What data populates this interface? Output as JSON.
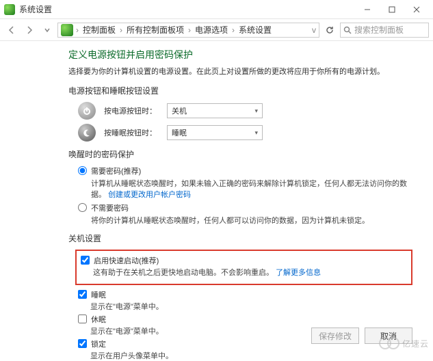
{
  "window": {
    "title": "系统设置",
    "min": "–",
    "max": "□",
    "close": "×"
  },
  "nav": {
    "crumbs": [
      "控制面板",
      "所有控制面板项",
      "电源选项",
      "系统设置"
    ],
    "search_placeholder": "搜索控制面板"
  },
  "heading": "定义电源按钮并启用密码保护",
  "subheading": "选择要为你的计算机设置的电源设置。在此页上对设置所做的更改将应用于你所有的电源计划。",
  "section_power_buttons": "电源按钮和睡眠按钮设置",
  "power_row": {
    "label": "按电源按钮时：",
    "value": "关机"
  },
  "sleep_row": {
    "label": "按睡眠按钮时：",
    "value": "睡眠"
  },
  "section_wake": "唤醒时的密码保护",
  "radio_require": {
    "label": "需要密码(推荐)",
    "desc_a": "计算机从睡眠状态唤醒时，如果未输入正确的密码来解除计算机锁定，任何人都无法访问你的数据。",
    "link": "创建或更改用户帐户密码"
  },
  "radio_none": {
    "label": "不需要密码",
    "desc": "将你的计算机从睡眠状态唤醒时，任何人都可以访问你的数据，因为计算机未锁定。"
  },
  "section_shutdown": "关机设置",
  "fast_start": {
    "label": "启用快速启动(推荐)",
    "desc": "这有助于在关机之后更快地启动电脑。不会影响重启。",
    "link": "了解更多信息"
  },
  "sleep_ck": {
    "label": "睡眠",
    "desc": "显示在\"电源\"菜单中。"
  },
  "hibernate_ck": {
    "label": "休眠",
    "desc": "显示在\"电源\"菜单中。"
  },
  "lock_ck": {
    "label": "锁定",
    "desc": "显示在用户头像菜单中。"
  },
  "buttons": {
    "save": "保存修改",
    "cancel": "取消"
  },
  "watermark": "亿速云"
}
